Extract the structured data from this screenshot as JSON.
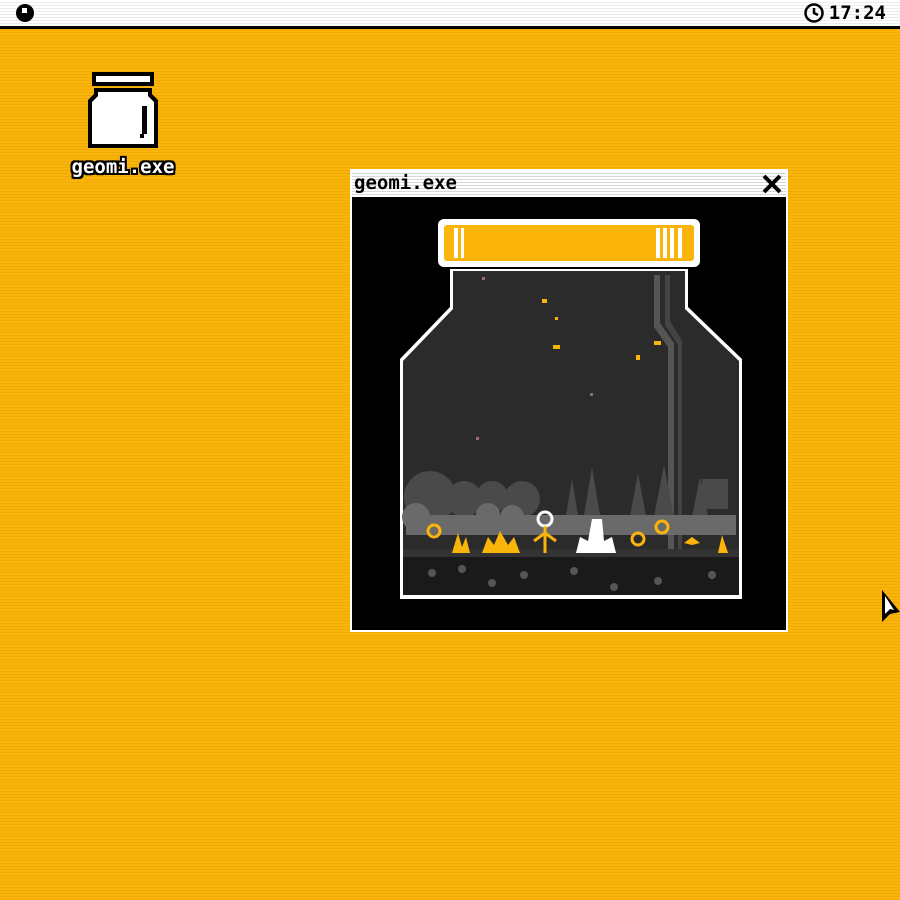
{
  "menubar": {
    "system_icon": "system-menu-icon",
    "clock_icon": "clock-icon",
    "clock_time": "17:24"
  },
  "desktop": {
    "background_color": "#fbb50a",
    "icons": [
      {
        "label": "geomi.exe",
        "icon": "jar-icon"
      }
    ]
  },
  "window": {
    "title": "geomi.exe",
    "close_icon": "close-icon",
    "content": "jar-terrarium-illustration"
  },
  "colors": {
    "accent": "#fbb50a",
    "window_bg": "#000000",
    "jar_glass": "#2a2a2a"
  }
}
